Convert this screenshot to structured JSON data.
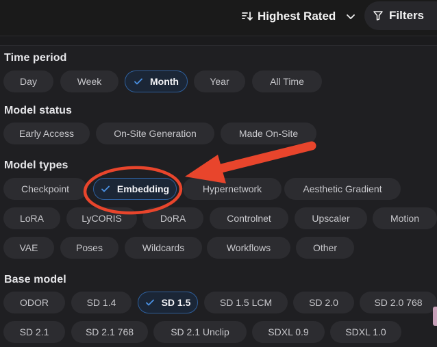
{
  "toolbar": {
    "sort_label": "Highest Rated",
    "filters_label": "Filters"
  },
  "filters": {
    "time_period": {
      "title": "Time period",
      "options": [
        "Day",
        "Week",
        "Month",
        "Year",
        "All Time"
      ],
      "selected": "Month"
    },
    "model_status": {
      "title": "Model status",
      "options": [
        "Early Access",
        "On-Site Generation",
        "Made On-Site"
      ]
    },
    "model_types": {
      "title": "Model types",
      "options": [
        "Checkpoint",
        "Embedding",
        "Hypernetwork",
        "Aesthetic Gradient",
        "LoRA",
        "LyCORIS",
        "DoRA",
        "Controlnet",
        "Upscaler",
        "Motion",
        "VAE",
        "Poses",
        "Wildcards",
        "Workflows",
        "Other"
      ],
      "selected": "Embedding"
    },
    "base_model": {
      "title": "Base model",
      "options": [
        "ODOR",
        "SD 1.4",
        "SD 1.5",
        "SD 1.5 LCM",
        "SD 2.0",
        "SD 2.0 768",
        "SD 2.1",
        "SD 2.1 768",
        "SD 2.1 Unclip",
        "SDXL 0.9",
        "SDXL 1.0"
      ],
      "selected": "SD 1.5"
    }
  },
  "colors": {
    "background": "#1b1b1d",
    "chip": "#2c2c30",
    "chip_selected_border": "#2e5f9c",
    "check": "#4a90e2",
    "annotation": "#e8452c"
  }
}
